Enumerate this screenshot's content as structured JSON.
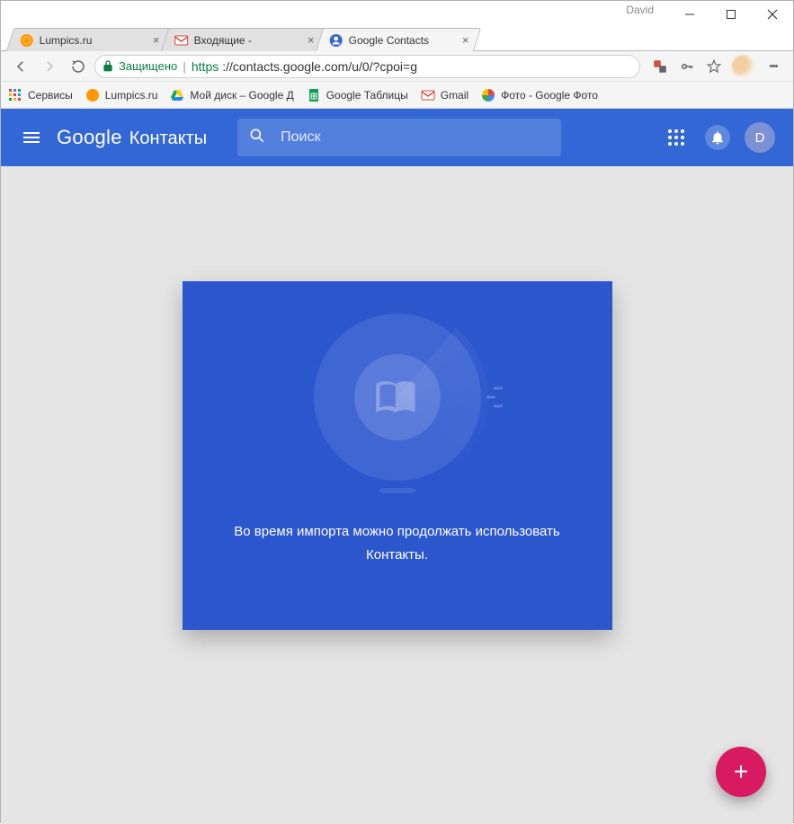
{
  "window": {
    "user_label": "David"
  },
  "tabs": [
    {
      "label": "Lumpics.ru"
    },
    {
      "label": "Входящие - "
    },
    {
      "label": "Google Contacts"
    }
  ],
  "toolbar": {
    "secure_label": "Защищено",
    "url_scheme": "https",
    "url_rest": "://contacts.google.com/u/0/?cpoi=g"
  },
  "bookmarks": [
    {
      "label": "Сервисы"
    },
    {
      "label": "Lumpics.ru"
    },
    {
      "label": "Мой диск – Google Д"
    },
    {
      "label": "Google Таблицы"
    },
    {
      "label": "Gmail"
    },
    {
      "label": "Фото - Google Фото"
    }
  ],
  "appbar": {
    "logo_brand": "Google",
    "logo_product": "Контакты",
    "search_placeholder": "Поиск",
    "account_initial": "D"
  },
  "card": {
    "line1": "Во время импорта можно продолжать использовать",
    "line2": "Контакты."
  },
  "fab": {
    "label": "+"
  }
}
